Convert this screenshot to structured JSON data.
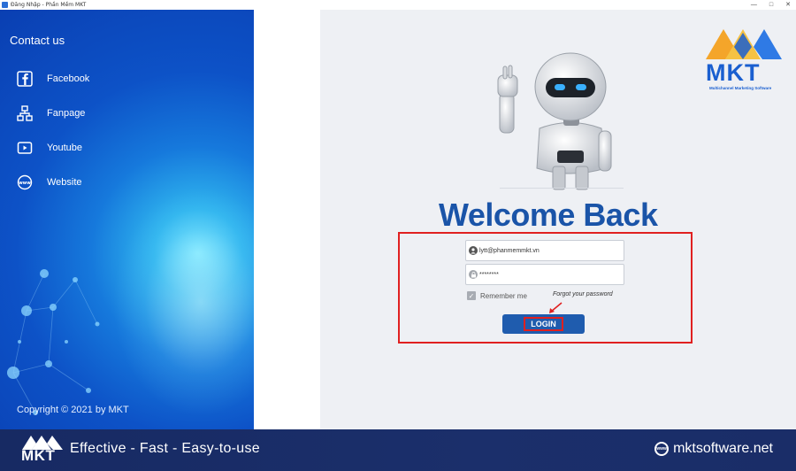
{
  "window": {
    "title": "Đăng Nhập - Phần Mềm MKT",
    "controls": [
      "—",
      "□",
      "✕"
    ]
  },
  "sidebar": {
    "title": "Contact us",
    "items": [
      {
        "label": "Facebook",
        "icon": "facebook-icon"
      },
      {
        "label": "Fanpage",
        "icon": "sitemap-icon"
      },
      {
        "label": "Youtube",
        "icon": "youtube-icon"
      },
      {
        "label": "Website",
        "icon": "www-icon"
      }
    ],
    "copyright": "Copyright © 2021 by MKT"
  },
  "logo": {
    "text": "MKT",
    "tagline": "Multichannel Marketing Software"
  },
  "login": {
    "heading": "Welcome Back",
    "username_value": "lytt@phanmemmkt.vn",
    "password_value": "********",
    "remember_label": "Remember me",
    "remember_checked": true,
    "forgot_label": "Forgot your password",
    "login_label": "LOGIN"
  },
  "banner": {
    "logo_text": "MKT",
    "slogan": "Effective - Fast - Easy-to-use",
    "website": "mktsoftware.net"
  },
  "colors": {
    "accent": "#1f5cae",
    "heading": "#1a54a8",
    "highlight": "#e02020",
    "banner": "#1b2f6b"
  }
}
